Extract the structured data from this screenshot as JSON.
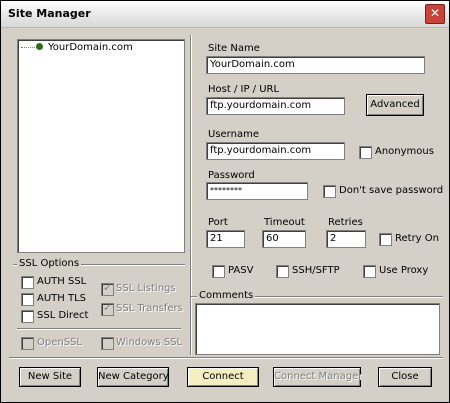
{
  "window": {
    "title": "Site Manager",
    "close_icon": "close-icon"
  },
  "tree": {
    "items": [
      {
        "label": "YourDomain.com"
      }
    ]
  },
  "ssl": {
    "group_label": "SSL Options",
    "auth_ssl": "AUTH SSL",
    "auth_tls": "AUTH TLS",
    "ssl_direct": "SSL Direct",
    "ssl_listings": "SSL Listings",
    "ssl_transfers": "SSL Transfers",
    "openssl": "OpenSSL",
    "windows_ssl": "Windows SSL"
  },
  "form": {
    "site_name_label": "Site Name",
    "site_name_value": "YourDomain.com",
    "host_label": "Host / IP / URL",
    "host_value": "ftp.yourdomain.com",
    "advanced_button": "Advanced",
    "username_label": "Username",
    "username_value": "ftp.yourdomain.com",
    "anonymous_label": "Anonymous",
    "password_label": "Password",
    "password_value": "********",
    "dont_save_label": "Don't save password",
    "port_label": "Port",
    "port_value": "21",
    "timeout_label": "Timeout",
    "timeout_value": "60",
    "retries_label": "Retries",
    "retries_value": "2",
    "retry_on_label": "Retry On",
    "pasv_label": "PASV",
    "ssh_label": "SSH/SFTP",
    "proxy_label": "Use Proxy",
    "comments_label": "Comments"
  },
  "buttons": {
    "new_site": "New Site",
    "new_category": "New Category",
    "connect": "Connect",
    "connect_manager": "Connect Manager",
    "close": "Close"
  }
}
